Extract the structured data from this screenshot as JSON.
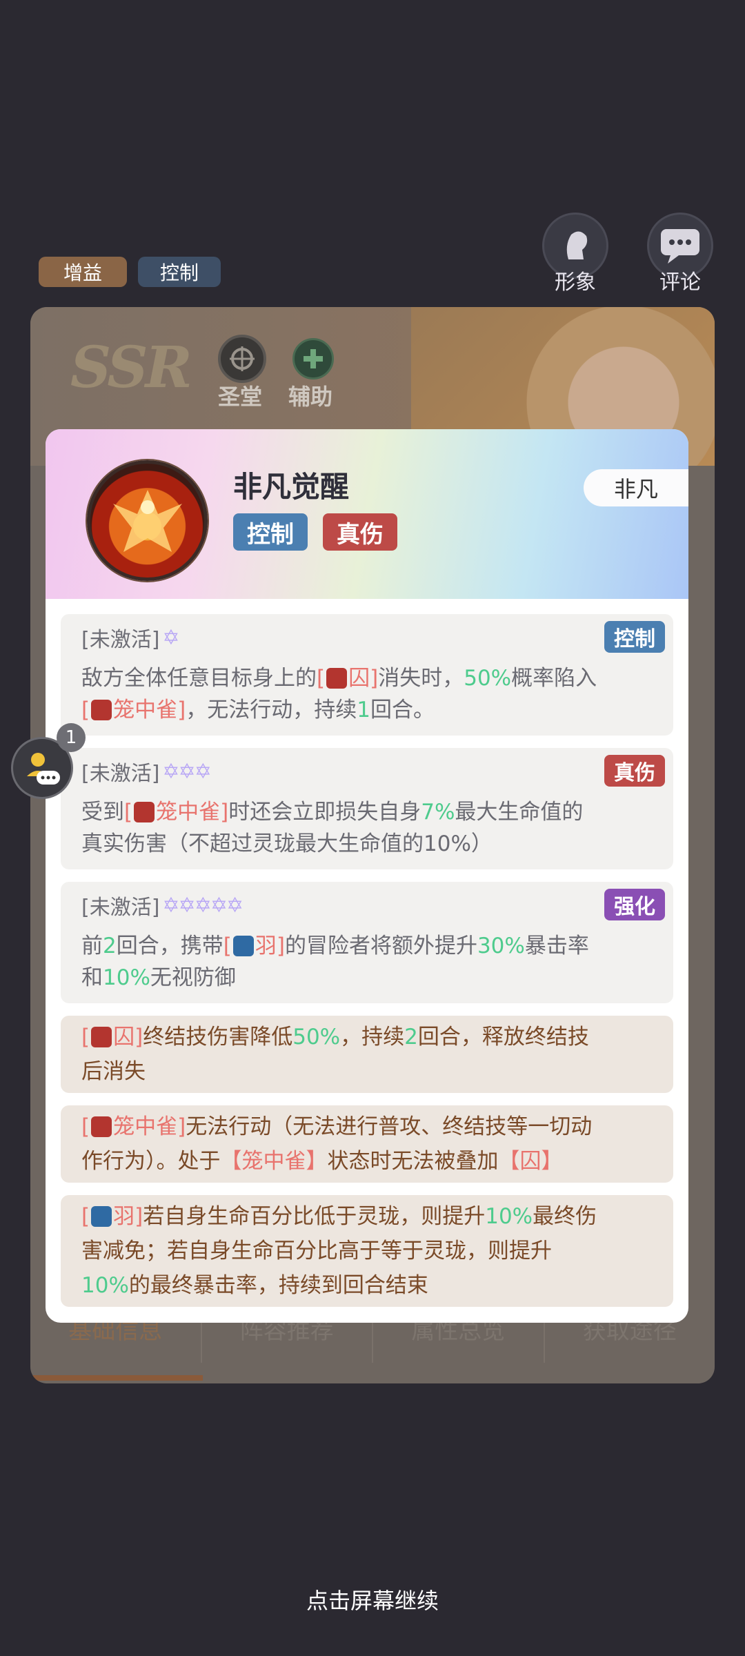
{
  "header": {
    "appearance_label": "形象",
    "comment_label": "评论"
  },
  "top_tags": [
    "增益",
    "控制"
  ],
  "hero_card": {
    "rarity": "SSR",
    "faction_label": "圣堂",
    "role_label": "辅助",
    "tabs": [
      "基础信息",
      "阵容推荐",
      "属性总览",
      "获取途径"
    ],
    "active_tab": "基础信息"
  },
  "popup": {
    "title": "非凡觉醒",
    "rarity": "非凡",
    "badges": [
      {
        "label": "控制",
        "color": "#4b7fb1"
      },
      {
        "label": "真伤",
        "color": "#bd4a47"
      }
    ],
    "sections": [
      {
        "status": "[未激活]",
        "stars": "✡",
        "tag": "控制",
        "tag_color": "#4b7fb1",
        "line1_a": "敌方全体任意目标身上的",
        "line1_b": "[",
        "line1_c": "囚]",
        "line1_d": "消失时，",
        "line1_e": "50%",
        "line1_f": "概率陷入",
        "line2_a": "[",
        "line2_b": "笼中雀]",
        "line2_c": "，无法行动，持续",
        "line2_d": "1",
        "line2_e": "回合。"
      },
      {
        "status": "[未激活]",
        "stars": "✡✡✡",
        "tag": "真伤",
        "tag_color": "#bd4a47",
        "line1_a": "受到",
        "line1_b": "[",
        "line1_c": "笼中雀]",
        "line1_d": "时还会立即损失自身",
        "line1_e": "7%",
        "line1_f": "最大生命值的",
        "line2": "真实伤害（不超过灵珑最大生命值的10%）"
      },
      {
        "status": "[未激活]",
        "stars": "✡✡✡✡✡",
        "tag": "强化",
        "tag_color": "#8a4fb4",
        "line1_a": "前",
        "line1_b": "2",
        "line1_c": "回合，携带",
        "line1_d": "[",
        "line1_e": "羽]",
        "line1_f": "的冒险者将额外提升",
        "line1_g": "30%",
        "line1_h": "暴击率",
        "line2_a": "和",
        "line2_b": "10%",
        "line2_c": "无视防御"
      }
    ],
    "notes": [
      {
        "a": "[",
        "b": "囚]",
        "c": "终结技伤害降低",
        "d": "50%",
        "e": "，持续",
        "f": "2",
        "g": "回合，释放终结技",
        "line2": "后消失"
      },
      {
        "a": "[",
        "b": "笼中雀]",
        "c": "无法行动（无法进行普攻、终结技等一切动",
        "line2_a": "作行为）。处于",
        "line2_b": "【笼中雀】",
        "line2_c": "状态时无法被叠加",
        "line2_d": "【囚】"
      },
      {
        "a": "[",
        "b": "羽]",
        "c": "若自身生命百分比低于灵珑，则提升",
        "d": "10%",
        "e": "最终伤",
        "line2": "害减免；若自身生命百分比高于等于灵珑，则提升",
        "line3_a": "10%",
        "line3_b": "的最终暴击率，持续到回合结束"
      }
    ]
  },
  "chat_bubble_count": "1",
  "continue_hint": "点击屏幕继续"
}
